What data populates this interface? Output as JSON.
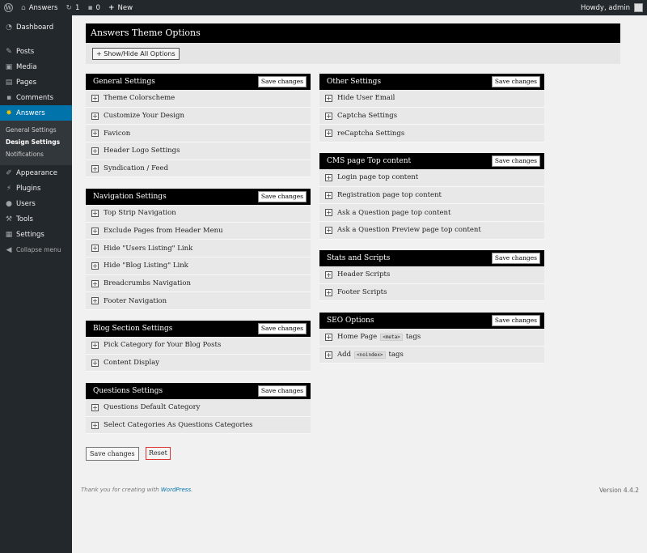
{
  "adminbar": {
    "site_name": "Answers",
    "updates_count": "1",
    "comments_count": "0",
    "new_label": "New",
    "howdy": "Howdy, admin"
  },
  "sidebar": {
    "items": [
      {
        "label": "Dashboard"
      },
      {
        "label": "Posts"
      },
      {
        "label": "Media"
      },
      {
        "label": "Pages"
      },
      {
        "label": "Comments"
      },
      {
        "label": "Answers"
      },
      {
        "label": "Appearance"
      },
      {
        "label": "Plugins"
      },
      {
        "label": "Users"
      },
      {
        "label": "Tools"
      },
      {
        "label": "Settings"
      },
      {
        "label": "Collapse menu"
      }
    ],
    "submenu": [
      {
        "label": "General Settings"
      },
      {
        "label": "Design Settings"
      },
      {
        "label": "Notifications"
      }
    ]
  },
  "page": {
    "title": "Answers Theme Options",
    "toggle_all": "+ Show/Hide All Options"
  },
  "save_label": "Save changes",
  "sections": {
    "general": {
      "title": "General Settings",
      "rows": [
        "Theme Colorscheme",
        "Customize Your Design",
        "Favicon",
        "Header Logo Settings",
        "Syndication / Feed"
      ]
    },
    "navigation": {
      "title": "Navigation Settings",
      "rows": [
        "Top Strip Navigation",
        "Exclude Pages from Header Menu",
        "Hide \"Users Listing\" Link",
        "Hide \"Blog Listing\" Link",
        "Breadcrumbs Navigation",
        "Footer Navigation"
      ]
    },
    "blog": {
      "title": "Blog Section Settings",
      "rows": [
        "Pick Category for Your Blog Posts",
        "Content Display"
      ]
    },
    "questions": {
      "title": "Questions Settings",
      "rows": [
        "Questions Default Category",
        "Select Categories As Questions Categories"
      ]
    },
    "other": {
      "title": "Other Settings",
      "rows": [
        "Hide User Email",
        "Captcha Settings",
        "reCaptcha Settings"
      ]
    },
    "cms": {
      "title": "CMS page Top content",
      "rows": [
        "Login page top content",
        "Registration page top content",
        "Ask a Question page top content",
        "Ask a Question Preview page top content"
      ]
    },
    "stats": {
      "title": "Stats and Scripts",
      "rows": [
        "Header Scripts",
        "Footer Scripts"
      ]
    },
    "seo": {
      "title": "SEO Options",
      "home_pre": "Home Page",
      "home_code": "<meta>",
      "home_post": "tags",
      "add_pre": "Add",
      "add_code": "<noindex>",
      "add_post": "tags"
    }
  },
  "bottom": {
    "save": "Save changes",
    "reset": "Reset"
  },
  "footer": {
    "thanks": "Thank you for creating with ",
    "wp_link": "WordPress",
    "after_link": ".",
    "version": "Version 4.4.2"
  },
  "colors": {
    "admin_dark": "#23282d",
    "active_blue": "#0073aa",
    "reset_border": "#dd3333"
  }
}
